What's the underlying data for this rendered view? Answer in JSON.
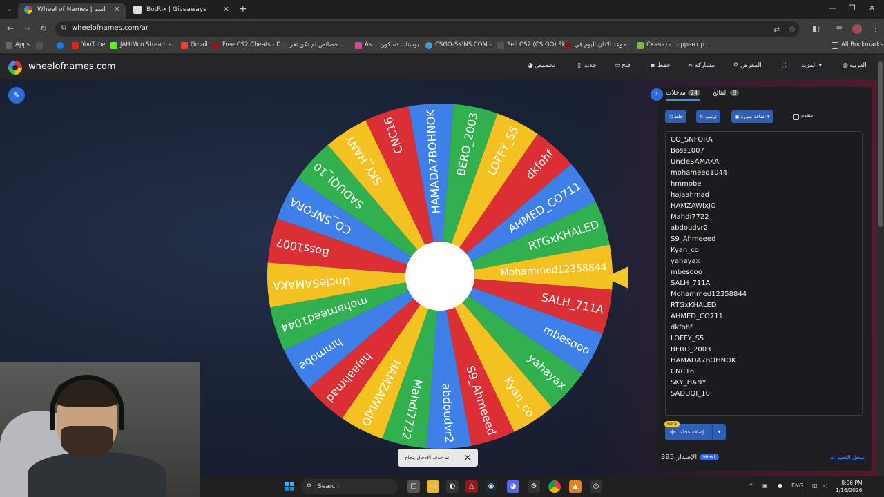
{
  "browser": {
    "tabs": [
      {
        "label": "Wheel of Names | اسم العشوائي",
        "active": true
      },
      {
        "label": "BotRix | Giveaways",
        "active": false
      }
    ],
    "url": "wheelofnames.com/ar",
    "bookmarks": [
      "Apps",
      "YouTube",
      "JAHIMco Stream -...",
      "Gmail",
      "Free CS2 Cheats - D...",
      "خصائص لم تكن تعر...",
      "As... بوستات دسكورد",
      "CSGO-SKINS.COM -...",
      "Sell CS2 (CS:GO) Ski...",
      "موعد الاذان اليوم في...",
      "Скачать торрент р...",
      "All Bookmarks"
    ]
  },
  "site": {
    "name": "wheelofnames.com",
    "menu": [
      "تخصيص",
      "جديد",
      "فتح",
      "حفظ",
      "مشاركة",
      "المعرض",
      "المزيد",
      "العربية"
    ]
  },
  "wheel": {
    "segments": [
      "Mohammed12358844",
      "SALH_711A",
      "mbesooo",
      "yahayax",
      "Kyan_co",
      "S9_Ahmeeed",
      "abdoudvr2",
      "Mahdi7722",
      "HAMZAWIxJO",
      "hajaahmad",
      "hmmobe",
      "mohameed1044",
      "UncleSAMAKA",
      "Boss1007",
      "CO_SNFORA",
      "SADUQI_10",
      "SKY_HANY",
      "CNC16",
      "HAMADA7BOHNOK",
      "BERO_2003",
      "LOFFY_S5",
      "dkfohf",
      "AHMED_CO711",
      "RTGxKHALED"
    ],
    "colors": [
      "#f3c122",
      "#db2f36",
      "#3f80e8",
      "#32b050"
    ]
  },
  "panel": {
    "tab_entries": "مدخلات",
    "entries_count": "24",
    "tab_results": "النتائج",
    "results_count": "8",
    "shuffle": "خلط",
    "sort": "ترتيب",
    "add_image": "إضافة صورة",
    "advanced": "متقدم",
    "entries": [
      "CO_SNFORA",
      "Boss1007",
      "UncleSAMAKA",
      "mohameed1044",
      "hmmobe",
      "hajaahmad",
      "HAMZAWIxJO",
      "Mahdi7722",
      "abdoudvr2",
      "S9_Ahmeeed",
      "Kyan_co",
      "yahayax",
      "mbesooo",
      "SALH_711A",
      "Mohammed12358844",
      "RTGxKHALED",
      "AHMED_CO711",
      "dkfohf",
      "LOFFY_S5",
      "BERO_2003",
      "HAMADA7BOHNOK",
      "CNC16",
      "SKY_HANY",
      "SADUQI_10"
    ],
    "beta": "Beta",
    "add_wheel": "إضافة عجلة",
    "version": "395 الإصدار",
    "new": "New!",
    "changelog": "سجل التغييرات"
  },
  "toast": {
    "text": "تم حذف الإدخال بنجاح"
  },
  "taskbar": {
    "search": "Search",
    "lang": "ENG",
    "time": "8:06 PM",
    "date": "1/16/2026"
  }
}
